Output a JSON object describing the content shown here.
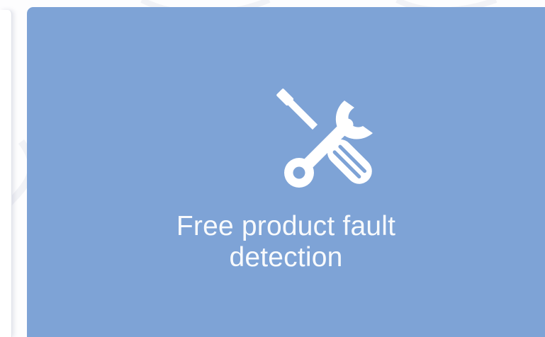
{
  "service_card": {
    "title_line1": "Free product fault",
    "title_line2": "detection",
    "icon": "tools-icon",
    "background_color": "#7ea3d6",
    "text_color": "#ffffff"
  },
  "background": {
    "color": "#fdfdfe"
  }
}
